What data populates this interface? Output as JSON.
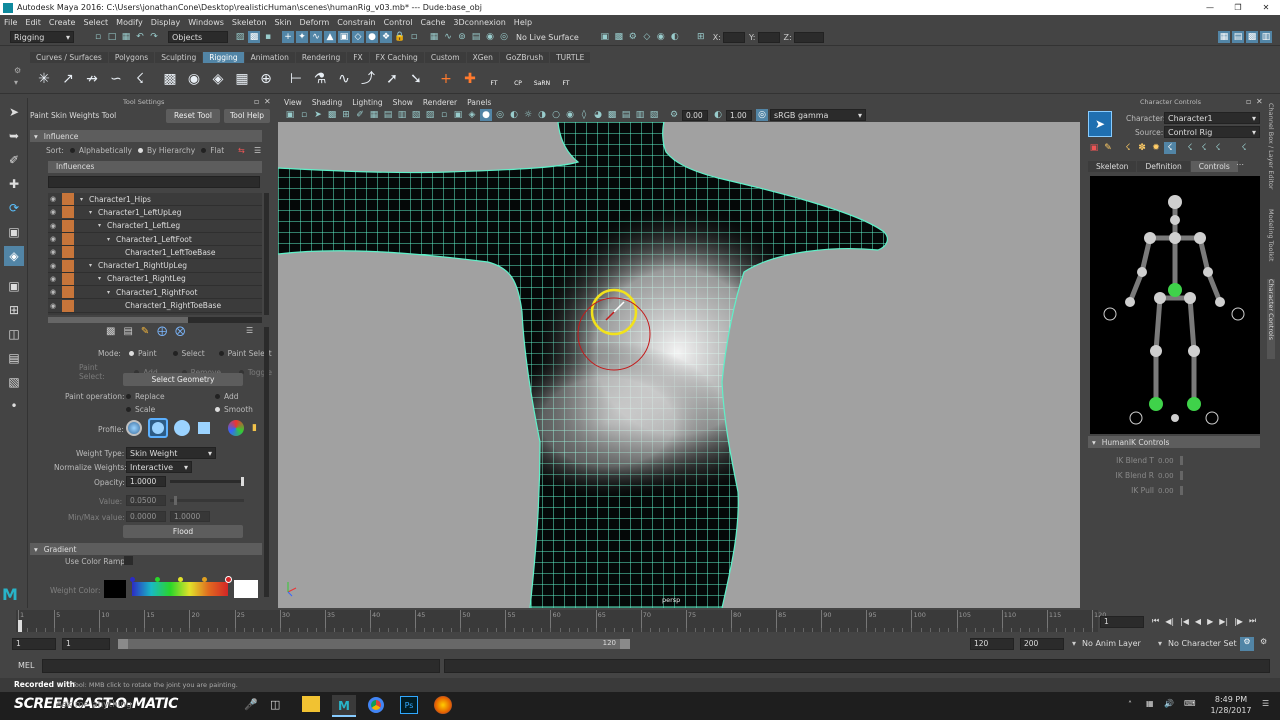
{
  "title": {
    "text": "Autodesk Maya 2016: C:\\Users\\jonathanCone\\Desktop\\realisticHuman\\scenes\\humanRig_v03.mb*   ---   Dude:base_obj"
  },
  "menu": [
    "File",
    "Edit",
    "Create",
    "Select",
    "Modify",
    "Display",
    "Windows",
    "Skeleton",
    "Skin",
    "Deform",
    "Constrain",
    "Control",
    "Cache",
    "3Dconnexion",
    "Help"
  ],
  "status": {
    "mode": "Rigging",
    "objects": "Objects",
    "live_surface": "No Live Surface",
    "x": "X:",
    "y": "Y:",
    "z": "Z:"
  },
  "shelf_tabs": [
    {
      "label": "Curves / Surfaces",
      "active": false
    },
    {
      "label": "Polygons",
      "active": false
    },
    {
      "label": "Sculpting",
      "active": false
    },
    {
      "label": "Rigging",
      "active": true
    },
    {
      "label": "Animation",
      "active": false
    },
    {
      "label": "Rendering",
      "active": false
    },
    {
      "label": "FX",
      "active": false
    },
    {
      "label": "FX Caching",
      "active": false
    },
    {
      "label": "Custom",
      "active": false
    },
    {
      "label": "XGen",
      "active": false
    },
    {
      "label": "GoZBrush",
      "active": false
    },
    {
      "label": "TURTLE",
      "active": false
    }
  ],
  "shelf_labels": {
    "ft": "FT",
    "cp": "CP",
    "sarn": "SaRN",
    "ft2": "FT"
  },
  "tool_settings": {
    "panel_title": "Tool Settings",
    "tool_name": "Paint Skin Weights Tool",
    "reset_tool": "Reset Tool",
    "tool_help": "Tool Help",
    "influence_header": "Influence",
    "sort_label": "Sort:",
    "sort_options": [
      "Alphabetically",
      "By Hierarchy",
      "Flat"
    ],
    "influences_label": "Influences",
    "influences": [
      {
        "name": "Character1_Hips",
        "depth": 0
      },
      {
        "name": "Character1_LeftUpLeg",
        "depth": 1
      },
      {
        "name": "Character1_LeftLeg",
        "depth": 2
      },
      {
        "name": "Character1_LeftFoot",
        "depth": 3
      },
      {
        "name": "Character1_LeftToeBase",
        "depth": 4
      },
      {
        "name": "Character1_RightUpLeg",
        "depth": 1
      },
      {
        "name": "Character1_RightLeg",
        "depth": 2
      },
      {
        "name": "Character1_RightFoot",
        "depth": 3
      },
      {
        "name": "Character1_RightToeBase",
        "depth": 4
      }
    ],
    "mode_label": "Mode:",
    "mode_options": [
      "Paint",
      "Select",
      "Paint Select"
    ],
    "paint_select_label": "Paint Select:",
    "paint_select_options": [
      "Add",
      "Remove",
      "Toggle"
    ],
    "select_geometry": "Select Geometry",
    "paint_operation_label": "Paint operation:",
    "paint_operations": [
      "Replace",
      "Add",
      "Scale",
      "Smooth"
    ],
    "profile_label": "Profile:",
    "weight_type_label": "Weight Type:",
    "weight_type": "Skin Weight",
    "normalize_label": "Normalize Weights:",
    "normalize": "Interactive",
    "opacity_label": "Opacity:",
    "opacity": "1.0000",
    "value_label": "Value:",
    "value": "0.0500",
    "minmax_label": "Min/Max value:",
    "min": "0.0000",
    "max": "1.0000",
    "flood": "Flood",
    "gradient_header": "Gradient",
    "use_color_ramp": "Use Color Ramp",
    "weight_color": "Weight Color:"
  },
  "viewport": {
    "menu": [
      "View",
      "Shading",
      "Lighting",
      "Show",
      "Renderer",
      "Panels"
    ],
    "field1": "0.00",
    "field2": "1.00",
    "color_space": "sRGB gamma",
    "camera_label": "persp"
  },
  "character_controls": {
    "panel_title": "Character Controls",
    "character_label": "Character:",
    "character": "Character1",
    "source_label": "Source:",
    "source": "Control Rig",
    "tabs": [
      "Skeleton",
      "Definition",
      "Controls"
    ],
    "active_tab": "Controls",
    "humanik_header": "HumanIK Controls",
    "ik_rows": [
      {
        "label": "IK Blend T",
        "value": "0.00"
      },
      {
        "label": "IK Blend R",
        "value": "0.00"
      },
      {
        "label": "IK Pull",
        "value": "0.00"
      }
    ]
  },
  "side_tabs": [
    "Channel Box / Layer Editor",
    "Modeling Toolkit",
    "Character Controls"
  ],
  "timeline": {
    "ticks": [
      "1",
      "5",
      "10",
      "15",
      "20",
      "25",
      "30",
      "35",
      "40",
      "45",
      "50",
      "55",
      "60",
      "65",
      "70",
      "75",
      "80",
      "85",
      "90",
      "95",
      "100",
      "105",
      "110",
      "115",
      "120"
    ],
    "current_frame": "1"
  },
  "range": {
    "start": "1",
    "inner_start": "1",
    "inner_end": "120",
    "end": "120",
    "total": "200",
    "anim_layer": "No Anim Layer",
    "char_set": "No Character Set"
  },
  "mel": {
    "label": "MEL"
  },
  "help_line": {
    "text": "Tool: MMB click to rotate the joint you are painting."
  },
  "watermark": {
    "recorded": "Recorded with",
    "brand": "SCREENCAST-O-MATIC"
  },
  "taskbar": {
    "search": "Ask me anything",
    "time": "8:49 PM",
    "date": "1/28/2017"
  },
  "colors": {
    "accent": "#5285a6",
    "wire": "#5ff0c8",
    "brush": "#f2e21b",
    "influence_swatch": "#c7753a",
    "joint_green": "#3fd24a"
  }
}
